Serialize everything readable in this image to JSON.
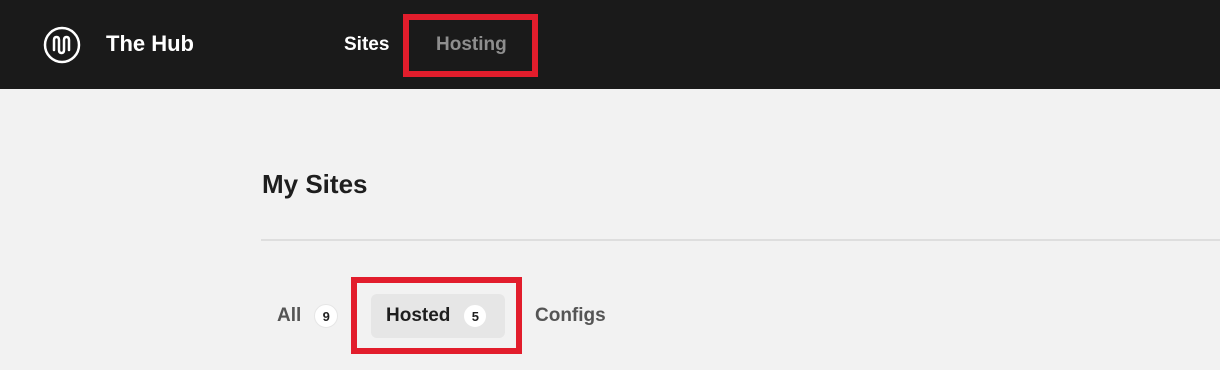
{
  "header": {
    "brand": "The Hub",
    "logo_icon": "hub-logo-icon",
    "nav": [
      {
        "label": "Sites",
        "active": true
      },
      {
        "label": "Hosting",
        "active": false
      }
    ]
  },
  "main": {
    "title": "My Sites",
    "tabs": [
      {
        "label": "All",
        "count": "9"
      },
      {
        "label": "Hosted",
        "count": "5",
        "selected": true
      },
      {
        "label": "Configs"
      }
    ]
  },
  "colors": {
    "topbar": "#1a1a1a",
    "background": "#f2f2f2",
    "highlight": "#e21d2c"
  }
}
